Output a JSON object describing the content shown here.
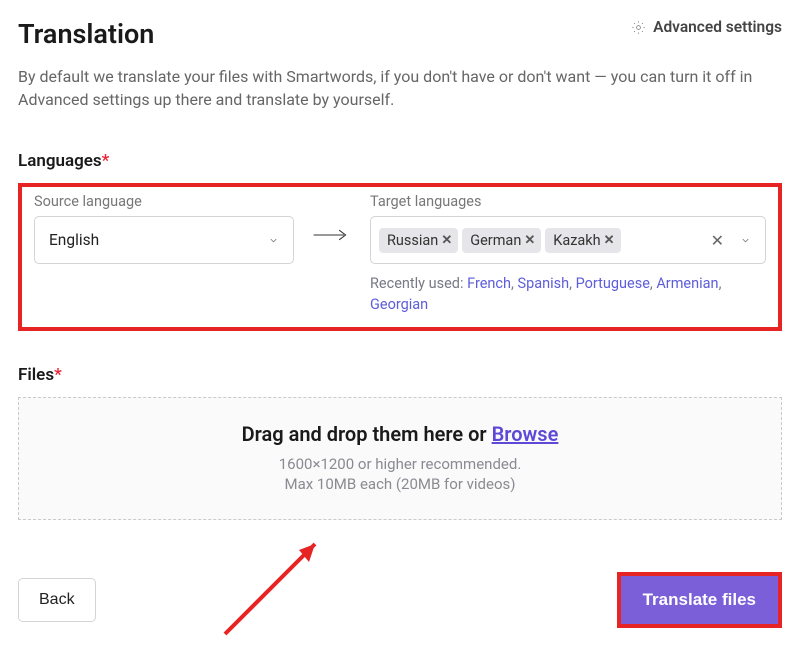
{
  "header": {
    "title": "Translation",
    "advancedSettings": "Advanced settings"
  },
  "description": "By default we translate your files with Smartwords, if you don't have or don't want — you can turn it off in Advanced settings up there and translate by yourself.",
  "languages": {
    "sectionLabel": "Languages",
    "required": "*",
    "sourceLabel": "Source language",
    "sourceValue": "English",
    "targetLabel": "Target languages",
    "targets": [
      "Russian",
      "German",
      "Kazakh"
    ],
    "recentLabel": "Recently used:",
    "recent": [
      "French",
      "Spanish",
      "Portuguese",
      "Armenian",
      "Georgian"
    ]
  },
  "files": {
    "sectionLabel": "Files",
    "required": "*",
    "dropPrefix": "Drag and drop them here or ",
    "browse": "Browse",
    "rec": "1600×1200 or higher recommended.",
    "max": "Max 10MB each (20MB for videos)"
  },
  "footer": {
    "back": "Back",
    "translate": "Translate files"
  }
}
